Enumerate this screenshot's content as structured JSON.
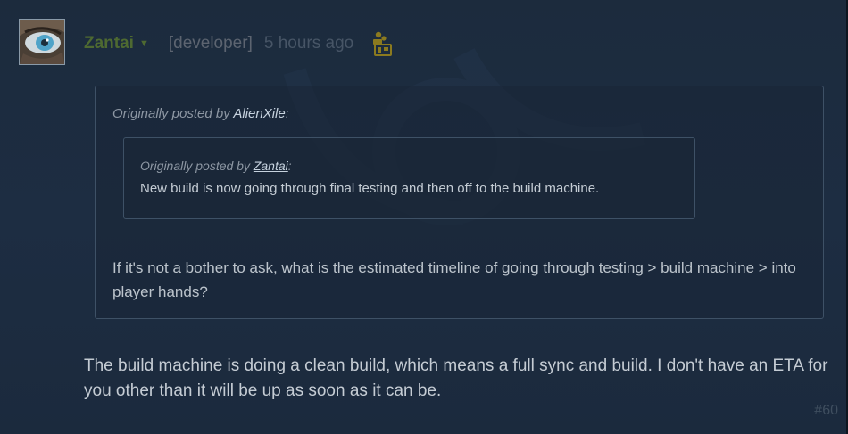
{
  "post": {
    "author": "Zantai",
    "role": "[developer]",
    "timestamp": "5 hours ago",
    "number": "#60",
    "reply_text": "The build machine is doing a clean build, which means a full sync and build. I don't have an ETA for you other than it will be up as soon as it can be."
  },
  "quote": {
    "prefix": "Originally posted by",
    "author": "AlienXile",
    "suffix": ":",
    "text": "If it's not a bother to ask, what is the estimated timeline of going through testing > build machine > into player hands?",
    "nested": {
      "prefix": "Originally posted by",
      "author": "Zantai",
      "suffix": ":",
      "text": "New build is now going through final testing and then off to the build machine."
    }
  },
  "colors": {
    "background": "#1b2838",
    "author": "#4e6a31",
    "border": "#3e5166"
  },
  "icons": {
    "avatar": "avatar",
    "dropdown": "chevron-down-icon",
    "developer_badge": "developer-badge-icon"
  }
}
